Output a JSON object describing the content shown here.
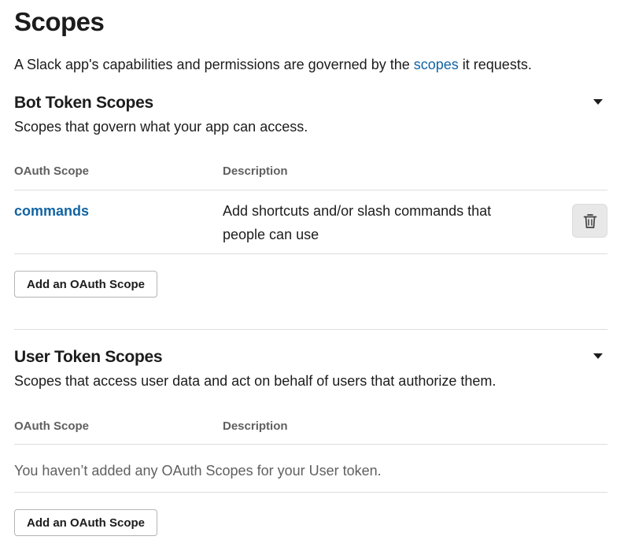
{
  "page": {
    "title": "Scopes",
    "intro_before": "A Slack app's capabilities and permissions are governed by the ",
    "intro_link": "scopes",
    "intro_after": " it requests."
  },
  "bot_section": {
    "title": "Bot Token Scopes",
    "description": "Scopes that govern what your app can access.",
    "col_scope": "OAuth Scope",
    "col_description": "Description",
    "rows": [
      {
        "scope": "commands",
        "description": "Add shortcuts and/or slash commands that people can use"
      }
    ],
    "add_button": "Add an OAuth Scope"
  },
  "user_section": {
    "title": "User Token Scopes",
    "description": "Scopes that access user data and act on behalf of users that authorize them.",
    "col_scope": "OAuth Scope",
    "col_description": "Description",
    "empty_message": "You haven’t added any OAuth Scopes for your User token.",
    "add_button": "Add an OAuth Scope"
  },
  "icons": {
    "collapse": "caret-down-icon",
    "remove": "trash-icon"
  },
  "colors": {
    "link": "#1264a3",
    "text": "#1d1c1d",
    "muted": "#616061",
    "divider": "#dddddd",
    "icon_button_bg": "#e8e8e8"
  }
}
